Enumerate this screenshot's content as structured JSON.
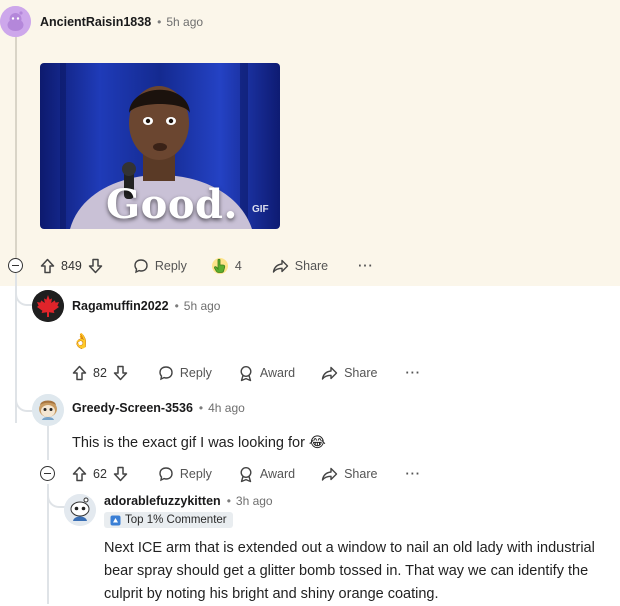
{
  "comments": [
    {
      "user": "AncientRaisin1838",
      "age": "5h ago",
      "gif": {
        "caption": "Good.",
        "tag": "GIF"
      },
      "votes": "849",
      "reply": "Reply",
      "award_count": "4",
      "share": "Share",
      "more": "···"
    },
    {
      "user": "Ragamuffin2022",
      "age": "5h ago",
      "text": "👌",
      "votes": "82",
      "reply": "Reply",
      "award": "Award",
      "share": "Share",
      "more": "···"
    },
    {
      "user": "Greedy-Screen-3536",
      "age": "4h ago",
      "text": "This is the exact gif I was looking for 😂",
      "votes": "62",
      "reply": "Reply",
      "award": "Award",
      "share": "Share",
      "more": "···"
    },
    {
      "user": "adorablefuzzykitten",
      "age": "3h ago",
      "flair": "Top 1% Commenter",
      "text": "Next ICE arm that is extended out a window to nail an old lady with industrial bear spray should get a glitter bomb tossed in. That way we can identify the culprit by noting his bright and shiny orange coating."
    }
  ],
  "separator": "•",
  "colors": {
    "highlight_bg": "#fbf6ea",
    "thread": "#d9d4c7",
    "flair_bg": "#e9edf0"
  }
}
